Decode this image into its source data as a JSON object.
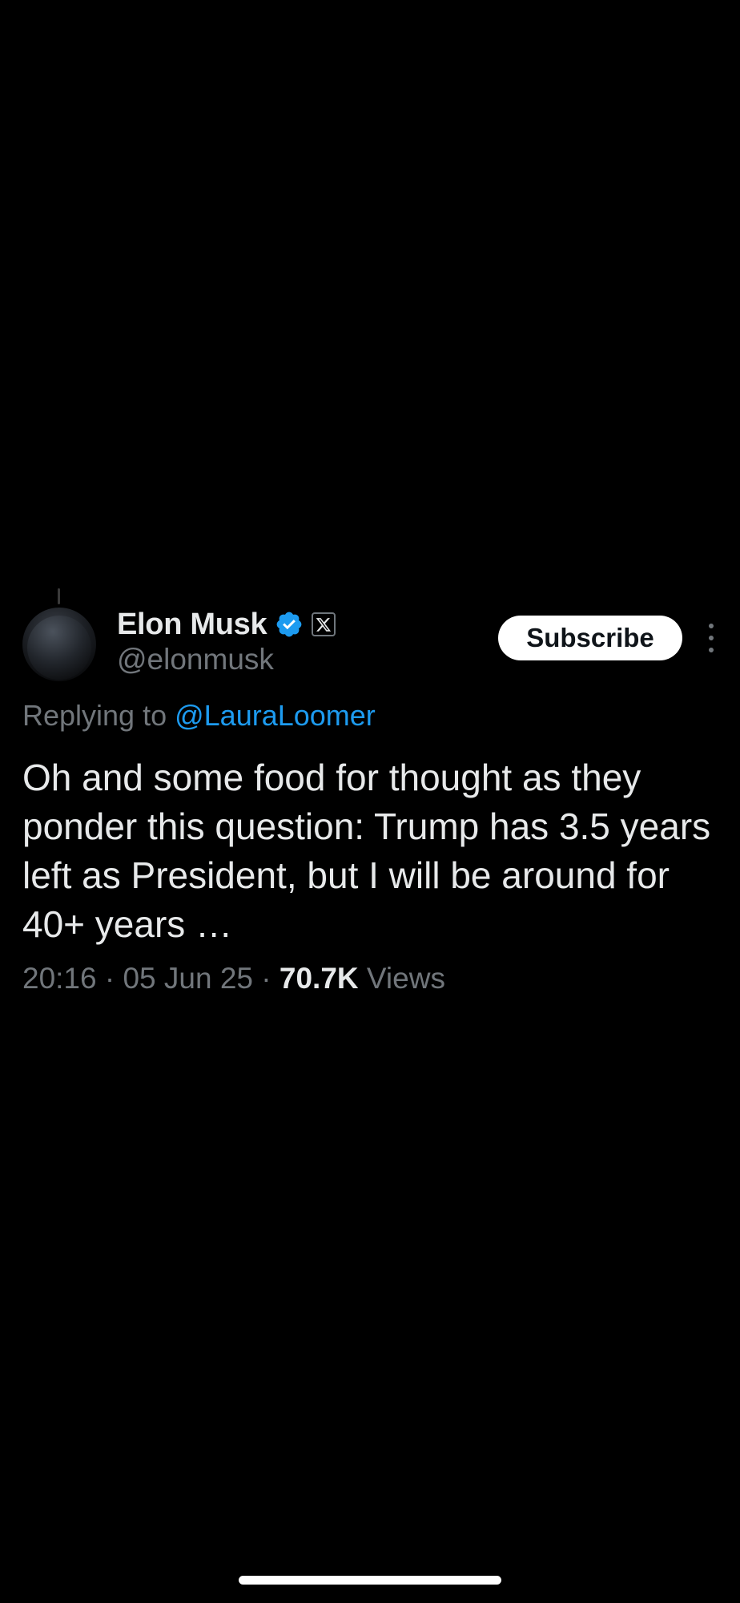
{
  "tweet": {
    "author": {
      "display_name": "Elon Musk",
      "handle": "@elonmusk",
      "verified": true,
      "affiliation_badge": "X"
    },
    "subscribe_label": "Subscribe",
    "reply_prefix": "Replying to ",
    "reply_mention": "@LauraLoomer",
    "text": "Oh and some food for thought as they ponder this question: Trump has 3.5 years left as President, but I will be around for 40+ years …",
    "time": "20:16",
    "separator": " · ",
    "date": "05 Jun 25",
    "views_count": "70.7K",
    "views_label": " Views"
  },
  "colors": {
    "background": "#000000",
    "primary_text": "#e7e9ea",
    "secondary_text": "#71767b",
    "accent": "#1d9bf0"
  },
  "icons": {
    "verified": "verified-badge-icon",
    "affiliation": "x-logo-icon",
    "more": "more-vertical-icon"
  }
}
